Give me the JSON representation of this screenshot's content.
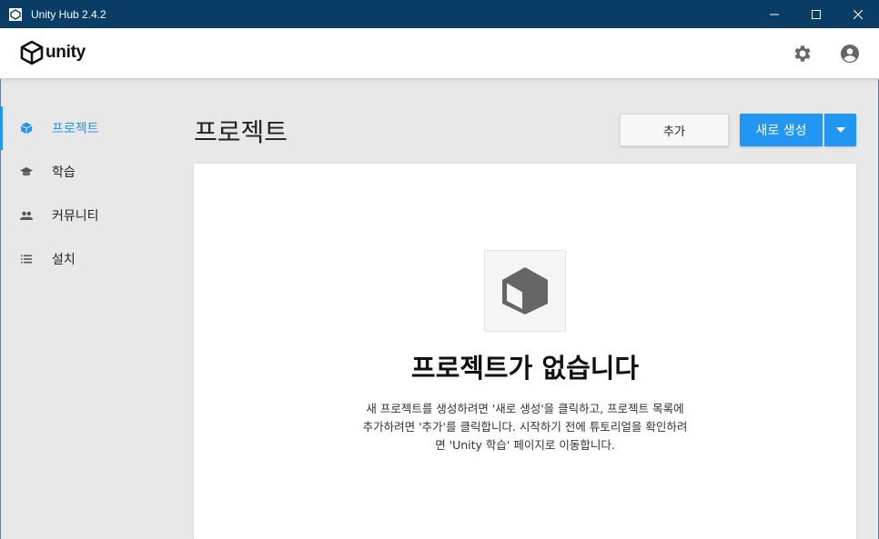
{
  "window": {
    "title": "Unity Hub 2.4.2",
    "controls": [
      "minimize-icon",
      "maximize-icon",
      "close-icon"
    ]
  },
  "header": {
    "logo_text": "unity",
    "icons": [
      "gear-icon",
      "account-icon"
    ]
  },
  "sidebar": {
    "items": [
      {
        "label": "프로젝트",
        "icon": "cube-icon",
        "active": true
      },
      {
        "label": "학습",
        "icon": "graduation-cap-icon",
        "active": false
      },
      {
        "label": "커뮤니티",
        "icon": "people-icon",
        "active": false
      },
      {
        "label": "설치",
        "icon": "list-icon",
        "active": false
      }
    ]
  },
  "main": {
    "title": "프로젝트",
    "add_button": "추가",
    "new_button": "새로 생성",
    "dropdown_icon": "caret-down-icon",
    "empty_state": {
      "icon": "cube-icon",
      "title": "프로젝트가 없습니다",
      "description_lines": [
        "새 프로젝트를 생성하려면 '새로 생성'을 클릭하고, 프로젝트 목록에",
        "추가하려면 '추가'를 클릭합니다. 시작하기 전에 튜토리얼을 확인하려",
        "면 'Unity 학습' 페이지로 이동합니다."
      ]
    }
  },
  "colors": {
    "titlebar": "#0a3d66",
    "accent": "#2196f3",
    "background": "#e8e8e8"
  }
}
